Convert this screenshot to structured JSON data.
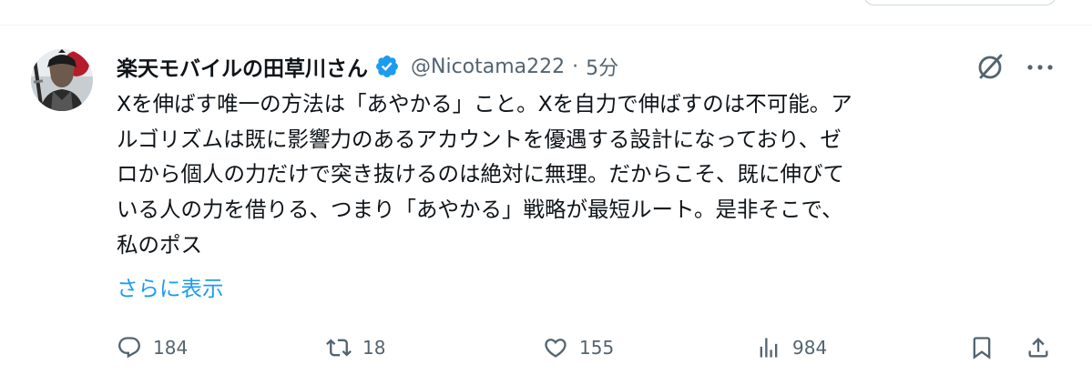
{
  "author": {
    "name": "楽天モバイルの田草川さん",
    "handle": "@Nicotama222",
    "separator": "·",
    "time": "5分"
  },
  "post": {
    "lines": [
      "Xを伸ばす唯一の方法は「あやかる」こと。Xを自力で伸ばすのは不可能。ア",
      "ルゴリズムは既に影響力のあるアカウントを優遇する設計になっており、ゼ",
      "ロから個人の力だけで突き抜けるのは絶対に無理。だからこそ、既に伸びて",
      "いる人の力を借りる、つまり「あやかる」戦略が最短ルート。是非そこで、",
      "私のポス"
    ],
    "show_more": "さらに表示"
  },
  "metrics": {
    "replies": "184",
    "reposts": "18",
    "likes": "155",
    "views": "984"
  },
  "icons": [
    "verified-badge-icon",
    "grok-icon",
    "more-icon",
    "reply-icon",
    "repost-icon",
    "like-icon",
    "views-icon",
    "bookmark-icon",
    "share-icon"
  ],
  "colors": {
    "accent": "#1d9bf0",
    "secondary_text": "#536471",
    "primary_text": "#0f1419"
  }
}
